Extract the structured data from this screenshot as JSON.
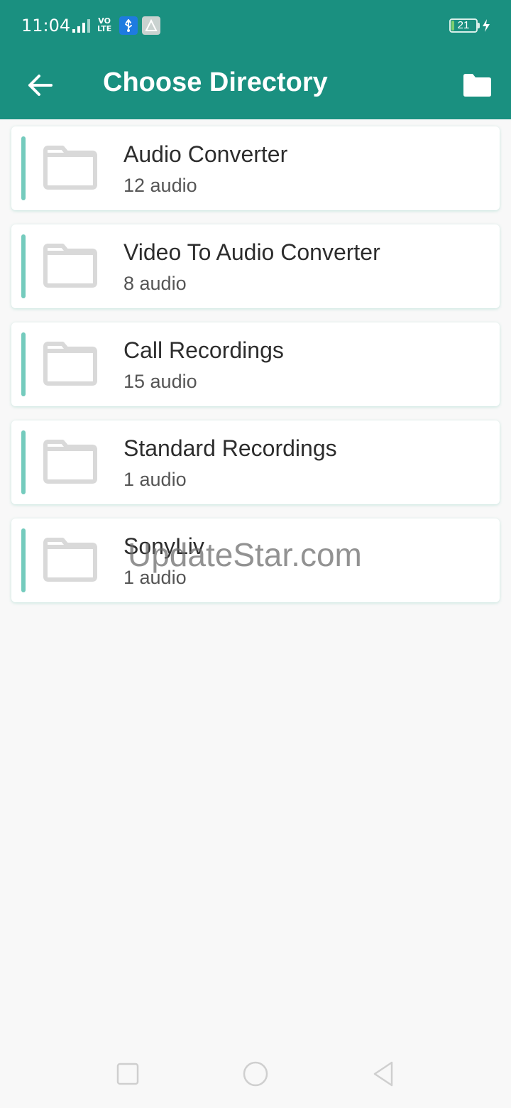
{
  "status_bar": {
    "time": "11:04",
    "network_label_top": "VO",
    "network_label_bottom": "LTE",
    "battery": "21",
    "icons": [
      "signal-icon",
      "usb-icon",
      "app-notification-icon",
      "battery-icon",
      "charging-icon"
    ]
  },
  "app_bar": {
    "title": "Choose Directory",
    "back_icon": "arrow-back-icon",
    "action_icon": "folder-icon"
  },
  "directories": [
    {
      "name": "Audio Converter",
      "count": "12 audio"
    },
    {
      "name": "Video To Audio Converter",
      "count": "8 audio"
    },
    {
      "name": "Call Recordings",
      "count": "15 audio"
    },
    {
      "name": "Standard Recordings",
      "count": "1 audio"
    },
    {
      "name": "SonyLiv",
      "count": "1 audio"
    }
  ],
  "watermark": "UpdateStar.com",
  "nav_bar": {
    "icons": [
      "recents-square-icon",
      "home-circle-icon",
      "back-triangle-icon"
    ]
  },
  "colors": {
    "primary": "#1a9080",
    "accent": "#74cbbd",
    "folder_gray": "#d9d9d9"
  }
}
